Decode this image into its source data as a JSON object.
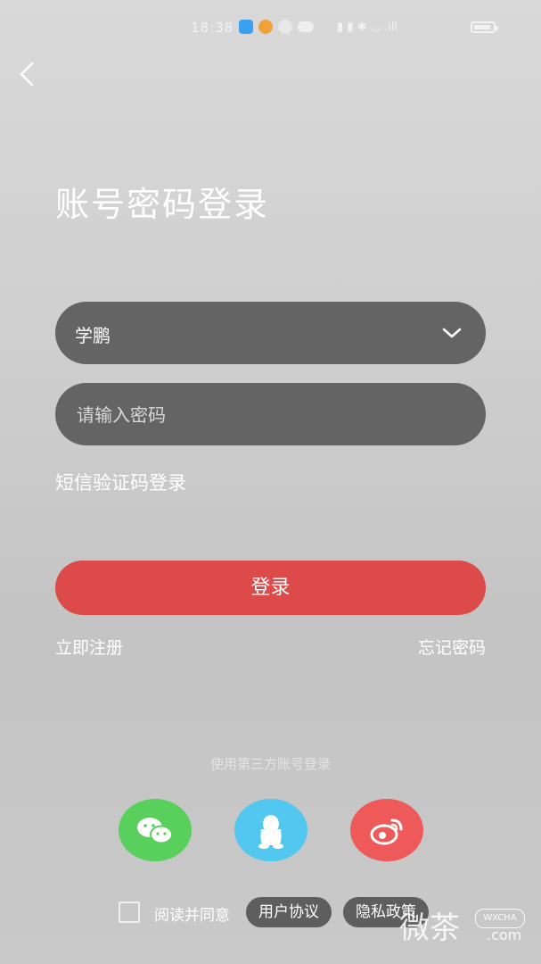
{
  "status_bar": {
    "time": "18:38",
    "indicators": "▮ ▮ ✱ ◡ .ıll"
  },
  "page": {
    "title": "账号密码登录"
  },
  "form": {
    "account_value": "学鹏",
    "password_placeholder": "请输入密码",
    "sms_login_label": "短信验证码登录",
    "login_button": "登录",
    "register_link": "立即注册",
    "forgot_link": "忘记密码"
  },
  "third_party": {
    "label": "使用第三方账号登录",
    "options": [
      "wechat",
      "qq",
      "weibo"
    ]
  },
  "agreement": {
    "text": "阅读并同意",
    "user_agreement": "用户协议",
    "privacy_policy": "隐私政策"
  },
  "watermark": {
    "text": "微茶",
    "badge": "WXCHA",
    "domain": ".com"
  },
  "colors": {
    "login_button": "#dd4a4a",
    "input_bg": "#646464",
    "wechat": "#59cf5c",
    "qq": "#52c8f0",
    "weibo": "#ee5a5a"
  }
}
